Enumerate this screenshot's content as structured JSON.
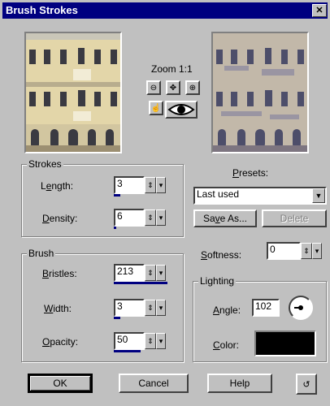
{
  "window": {
    "title": "Brush Strokes"
  },
  "zoom": {
    "label": "Zoom 1:1"
  },
  "strokes": {
    "legend": "Strokes",
    "length_label": "Length:",
    "length_value": "3",
    "density_label": "Density:",
    "density_value": "6"
  },
  "brush": {
    "legend": "Brush",
    "bristles_label": "Bristles:",
    "bristles_value": "213",
    "width_label": "Width:",
    "width_value": "3",
    "opacity_label": "Opacity:",
    "opacity_value": "50"
  },
  "presets": {
    "label": "Presets:",
    "selected": "Last used",
    "save_as": "Save As...",
    "delete": "Delete"
  },
  "softness": {
    "label": "Softness:",
    "value": "0"
  },
  "lighting": {
    "legend": "Lighting",
    "angle_label": "Angle:",
    "angle_value": "102",
    "color_label": "Color:",
    "color_value": "#000000"
  },
  "buttons": {
    "ok": "OK",
    "cancel": "Cancel",
    "help": "Help"
  },
  "icons": {
    "zoom_out": "zoom-out-icon",
    "pan": "pan-icon",
    "zoom_in": "zoom-in-icon",
    "hand": "hand-icon",
    "eye": "eye-preview-icon",
    "reset": "reset-defaults-icon"
  },
  "colors": {
    "titlebar": "#000080",
    "face": "#c0c0c0"
  }
}
